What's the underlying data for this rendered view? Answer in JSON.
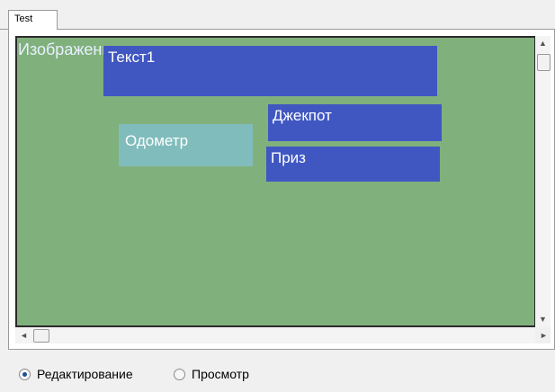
{
  "tab": {
    "label": "Test"
  },
  "canvas": {
    "background_label": "Изображение",
    "background_color": "#80b07c",
    "elements": [
      {
        "id": "text1",
        "label": "Текст1",
        "color": "#4057c2"
      },
      {
        "id": "odometer",
        "label": "Одометр",
        "color": "#81bcbc"
      },
      {
        "id": "jackpot",
        "label": "Джекпот",
        "color": "#4057c2"
      },
      {
        "id": "prize",
        "label": "Приз",
        "color": "#4057c2"
      }
    ]
  },
  "scrollbars": {
    "up_arrow": "▲",
    "down_arrow": "▼",
    "left_arrow": "◄",
    "right_arrow": "►"
  },
  "mode": {
    "options": [
      {
        "label": "Редактирование",
        "selected": true
      },
      {
        "label": "Просмотр",
        "selected": false
      }
    ]
  }
}
